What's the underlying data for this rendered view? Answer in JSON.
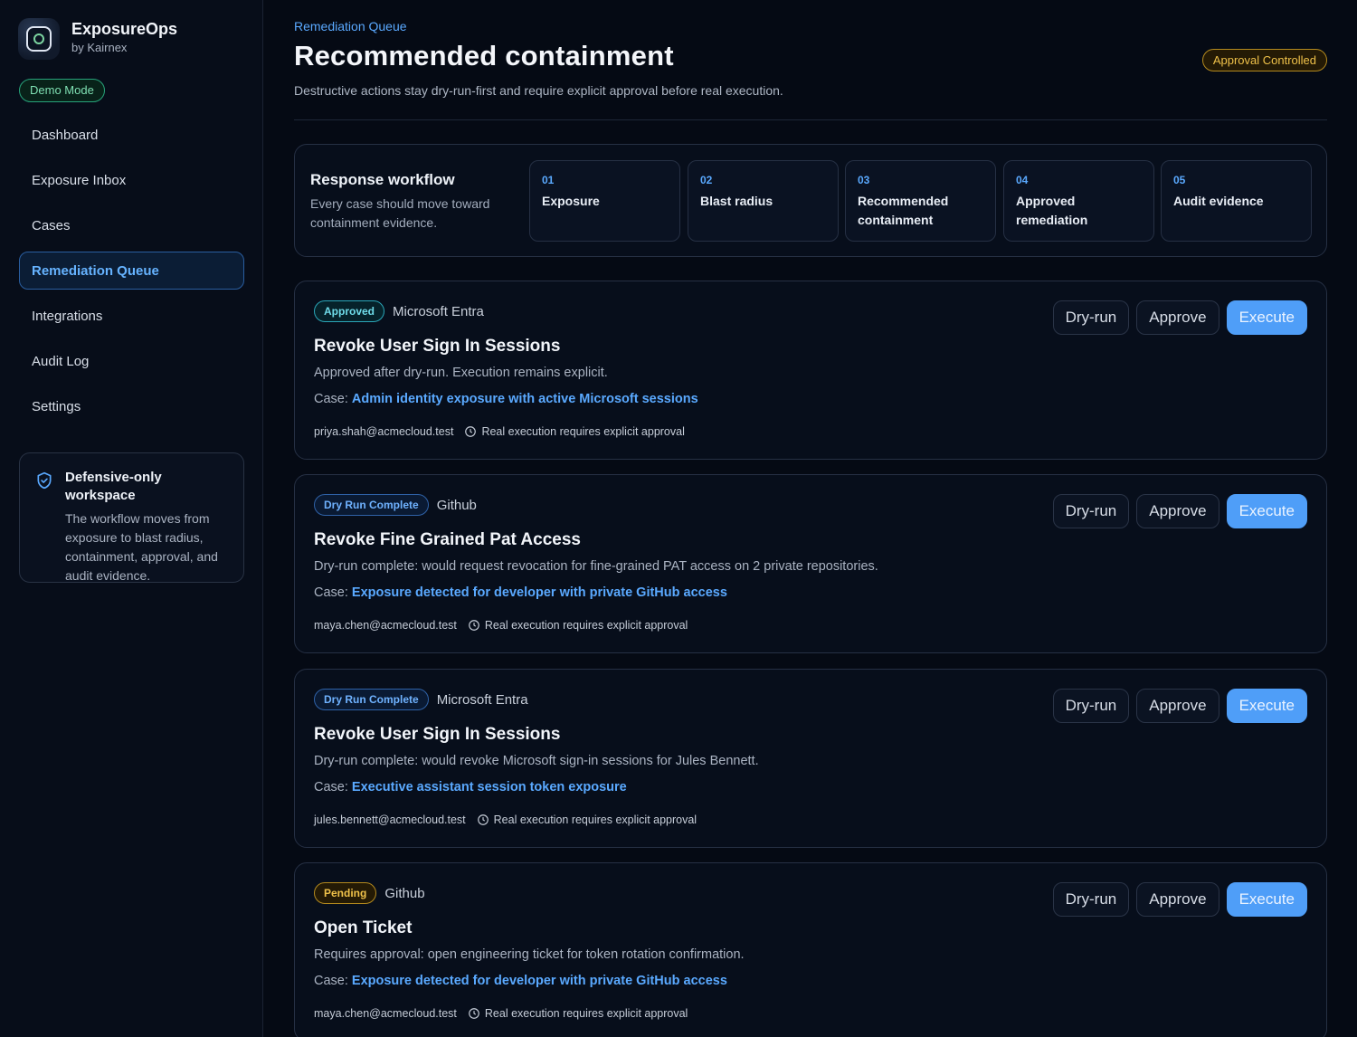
{
  "app": {
    "name": "ExposureOps",
    "by": "by Kairnex",
    "mode_badge": "Demo Mode"
  },
  "sidebar": {
    "items": [
      {
        "label": "Dashboard",
        "active": false
      },
      {
        "label": "Exposure Inbox",
        "active": false
      },
      {
        "label": "Cases",
        "active": false
      },
      {
        "label": "Remediation Queue",
        "active": true
      },
      {
        "label": "Integrations",
        "active": false
      },
      {
        "label": "Audit Log",
        "active": false
      },
      {
        "label": "Settings",
        "active": false
      }
    ],
    "info_card": {
      "title": "Defensive-only workspace",
      "body": "The workflow moves from exposure to blast radius, containment, approval, and audit evidence.",
      "icon": "shield-check-icon"
    }
  },
  "header": {
    "breadcrumb": "Remediation Queue",
    "title": "Recommended containment",
    "subtitle": "Destructive actions stay dry-run-first and require explicit approval before real execution.",
    "badge": "Approval Controlled"
  },
  "workflow": {
    "title": "Response workflow",
    "description": "Every case should move toward containment evidence.",
    "steps": [
      {
        "num": "01",
        "label": "Exposure"
      },
      {
        "num": "02",
        "label": "Blast radius"
      },
      {
        "num": "03",
        "label": "Recommended containment"
      },
      {
        "num": "04",
        "label": "Approved remediation"
      },
      {
        "num": "05",
        "label": "Audit evidence"
      }
    ]
  },
  "actions": {
    "dry_run": "Dry-run",
    "approve": "Approve",
    "execute": "Execute"
  },
  "case_prefix": "Case:",
  "cards": [
    {
      "status": "Approved",
      "status_kind": "approved",
      "provider": "Microsoft Entra",
      "title": "Revoke User Sign In Sessions",
      "description": "Approved after dry-run. Execution remains explicit.",
      "case_link": "Admin identity exposure with active Microsoft sessions",
      "user": "priya.shah@acmecloud.test",
      "note": "Real execution requires explicit approval"
    },
    {
      "status": "Dry Run Complete",
      "status_kind": "dry",
      "provider": "Github",
      "title": "Revoke Fine Grained Pat Access",
      "description": "Dry-run complete: would request revocation for fine-grained PAT access on 2 private repositories.",
      "case_link": "Exposure detected for developer with private GitHub access",
      "user": "maya.chen@acmecloud.test",
      "note": "Real execution requires explicit approval"
    },
    {
      "status": "Dry Run Complete",
      "status_kind": "dry",
      "provider": "Microsoft Entra",
      "title": "Revoke User Sign In Sessions",
      "description": "Dry-run complete: would revoke Microsoft sign-in sessions for Jules Bennett.",
      "case_link": "Executive assistant session token exposure",
      "user": "jules.bennett@acmecloud.test",
      "note": "Real execution requires explicit approval"
    },
    {
      "status": "Pending",
      "status_kind": "pending",
      "provider": "Github",
      "title": "Open Ticket",
      "description": "Requires approval: open engineering ticket for token rotation confirmation.",
      "case_link": "Exposure detected for developer with private GitHub access",
      "user": "maya.chen@acmecloud.test",
      "note": "Real execution requires explicit approval"
    }
  ],
  "colors": {
    "accent": "#5aa9ff",
    "execute": "#4f9ef8",
    "background": "#050a14",
    "approved": "#6fdce9",
    "pending": "#f0c24a",
    "demo": "#7fe0b3"
  }
}
